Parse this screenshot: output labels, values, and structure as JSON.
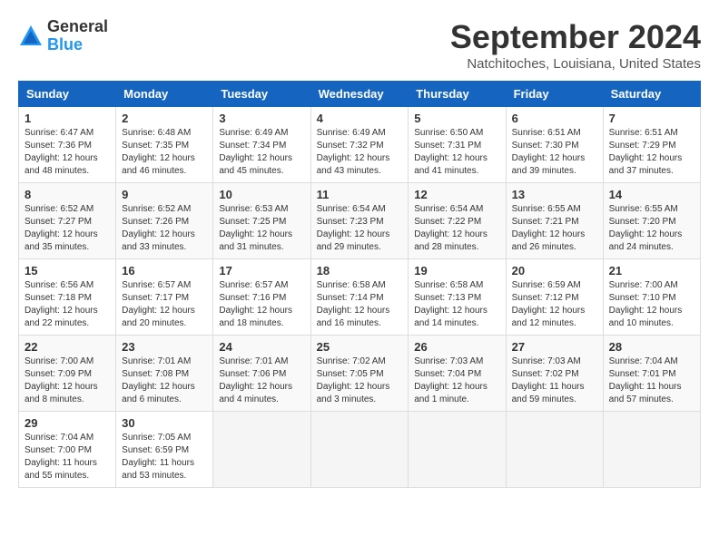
{
  "header": {
    "logo_general": "General",
    "logo_blue": "Blue",
    "month_title": "September 2024",
    "location": "Natchitoches, Louisiana, United States"
  },
  "days_of_week": [
    "Sunday",
    "Monday",
    "Tuesday",
    "Wednesday",
    "Thursday",
    "Friday",
    "Saturday"
  ],
  "weeks": [
    [
      {
        "day": "1",
        "info": "Sunrise: 6:47 AM\nSunset: 7:36 PM\nDaylight: 12 hours\nand 48 minutes."
      },
      {
        "day": "2",
        "info": "Sunrise: 6:48 AM\nSunset: 7:35 PM\nDaylight: 12 hours\nand 46 minutes."
      },
      {
        "day": "3",
        "info": "Sunrise: 6:49 AM\nSunset: 7:34 PM\nDaylight: 12 hours\nand 45 minutes."
      },
      {
        "day": "4",
        "info": "Sunrise: 6:49 AM\nSunset: 7:32 PM\nDaylight: 12 hours\nand 43 minutes."
      },
      {
        "day": "5",
        "info": "Sunrise: 6:50 AM\nSunset: 7:31 PM\nDaylight: 12 hours\nand 41 minutes."
      },
      {
        "day": "6",
        "info": "Sunrise: 6:51 AM\nSunset: 7:30 PM\nDaylight: 12 hours\nand 39 minutes."
      },
      {
        "day": "7",
        "info": "Sunrise: 6:51 AM\nSunset: 7:29 PM\nDaylight: 12 hours\nand 37 minutes."
      }
    ],
    [
      {
        "day": "8",
        "info": "Sunrise: 6:52 AM\nSunset: 7:27 PM\nDaylight: 12 hours\nand 35 minutes."
      },
      {
        "day": "9",
        "info": "Sunrise: 6:52 AM\nSunset: 7:26 PM\nDaylight: 12 hours\nand 33 minutes."
      },
      {
        "day": "10",
        "info": "Sunrise: 6:53 AM\nSunset: 7:25 PM\nDaylight: 12 hours\nand 31 minutes."
      },
      {
        "day": "11",
        "info": "Sunrise: 6:54 AM\nSunset: 7:23 PM\nDaylight: 12 hours\nand 29 minutes."
      },
      {
        "day": "12",
        "info": "Sunrise: 6:54 AM\nSunset: 7:22 PM\nDaylight: 12 hours\nand 28 minutes."
      },
      {
        "day": "13",
        "info": "Sunrise: 6:55 AM\nSunset: 7:21 PM\nDaylight: 12 hours\nand 26 minutes."
      },
      {
        "day": "14",
        "info": "Sunrise: 6:55 AM\nSunset: 7:20 PM\nDaylight: 12 hours\nand 24 minutes."
      }
    ],
    [
      {
        "day": "15",
        "info": "Sunrise: 6:56 AM\nSunset: 7:18 PM\nDaylight: 12 hours\nand 22 minutes."
      },
      {
        "day": "16",
        "info": "Sunrise: 6:57 AM\nSunset: 7:17 PM\nDaylight: 12 hours\nand 20 minutes."
      },
      {
        "day": "17",
        "info": "Sunrise: 6:57 AM\nSunset: 7:16 PM\nDaylight: 12 hours\nand 18 minutes."
      },
      {
        "day": "18",
        "info": "Sunrise: 6:58 AM\nSunset: 7:14 PM\nDaylight: 12 hours\nand 16 minutes."
      },
      {
        "day": "19",
        "info": "Sunrise: 6:58 AM\nSunset: 7:13 PM\nDaylight: 12 hours\nand 14 minutes."
      },
      {
        "day": "20",
        "info": "Sunrise: 6:59 AM\nSunset: 7:12 PM\nDaylight: 12 hours\nand 12 minutes."
      },
      {
        "day": "21",
        "info": "Sunrise: 7:00 AM\nSunset: 7:10 PM\nDaylight: 12 hours\nand 10 minutes."
      }
    ],
    [
      {
        "day": "22",
        "info": "Sunrise: 7:00 AM\nSunset: 7:09 PM\nDaylight: 12 hours\nand 8 minutes."
      },
      {
        "day": "23",
        "info": "Sunrise: 7:01 AM\nSunset: 7:08 PM\nDaylight: 12 hours\nand 6 minutes."
      },
      {
        "day": "24",
        "info": "Sunrise: 7:01 AM\nSunset: 7:06 PM\nDaylight: 12 hours\nand 4 minutes."
      },
      {
        "day": "25",
        "info": "Sunrise: 7:02 AM\nSunset: 7:05 PM\nDaylight: 12 hours\nand 3 minutes."
      },
      {
        "day": "26",
        "info": "Sunrise: 7:03 AM\nSunset: 7:04 PM\nDaylight: 12 hours\nand 1 minute."
      },
      {
        "day": "27",
        "info": "Sunrise: 7:03 AM\nSunset: 7:02 PM\nDaylight: 11 hours\nand 59 minutes."
      },
      {
        "day": "28",
        "info": "Sunrise: 7:04 AM\nSunset: 7:01 PM\nDaylight: 11 hours\nand 57 minutes."
      }
    ],
    [
      {
        "day": "29",
        "info": "Sunrise: 7:04 AM\nSunset: 7:00 PM\nDaylight: 11 hours\nand 55 minutes."
      },
      {
        "day": "30",
        "info": "Sunrise: 7:05 AM\nSunset: 6:59 PM\nDaylight: 11 hours\nand 53 minutes."
      },
      {
        "day": "",
        "info": ""
      },
      {
        "day": "",
        "info": ""
      },
      {
        "day": "",
        "info": ""
      },
      {
        "day": "",
        "info": ""
      },
      {
        "day": "",
        "info": ""
      }
    ]
  ]
}
